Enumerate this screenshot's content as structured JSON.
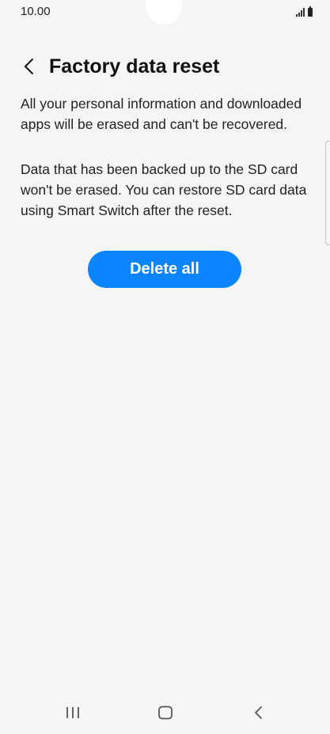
{
  "status_bar": {
    "time": "10.00",
    "icons": [
      "signal-icon",
      "battery-icon"
    ]
  },
  "header": {
    "back_icon": "chevron-left-icon",
    "title": "Factory data reset"
  },
  "content": {
    "paragraph_1": "All your personal information and downloaded apps will be erased and can't be recovered.",
    "paragraph_2": "Data that has been backed up to the SD card won't be erased. You can restore SD card data using Smart Switch after the reset."
  },
  "actions": {
    "delete_all_label": "Delete all"
  },
  "colors": {
    "accent": "#0a84ff",
    "background": "#f5f5f5"
  },
  "nav_bar": {
    "icons": [
      "recents-icon",
      "home-icon",
      "back-icon"
    ]
  }
}
